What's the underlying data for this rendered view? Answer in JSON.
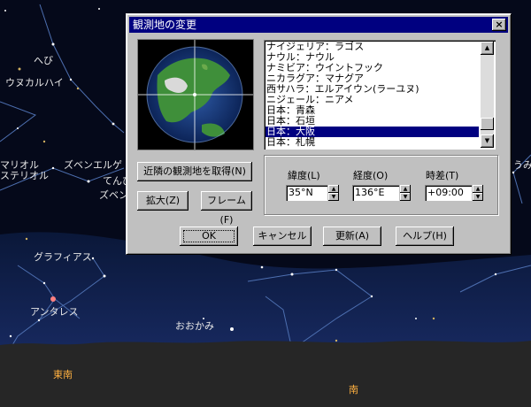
{
  "window": {
    "title": "観測地の変更",
    "close_glyph": "×"
  },
  "locations": [
    "ナイジェリア：ラゴス",
    "ナウル：ナウル",
    "ナミビア：ウイントフック",
    "ニカラグア：マナグア",
    "西サハラ：エルアイウン(ラーユヌ)",
    "ニジェール：ニアメ",
    "日本：青森",
    "日本：石垣",
    "日本：大阪",
    "日本：札幌"
  ],
  "selected_index": 8,
  "buttons": {
    "nearest": "近隣の観測地を取得(N)",
    "zoom": "拡大(Z)",
    "frame": "フレーム(F)",
    "ok": "OK",
    "cancel": "キャンセル",
    "update": "更新(A)",
    "help": "ヘルプ(H)"
  },
  "fields": {
    "latitude_label": "緯度(L)",
    "longitude_label": "経度(O)",
    "timezone_label": "時差(T)",
    "latitude_value": "35°N",
    "longitude_value": "136°E",
    "timezone_value": "+09:00"
  },
  "sky_labels": {
    "hebi": "へび",
    "ozhukahai": "ウヌカルハイ",
    "zubenelgenubi": "ズベンエルゲ",
    "tenbin": "てんび",
    "zubenelgenubi2": "ズベン",
    "mariolu": "マリオル",
    "sterior": "ステリオル",
    "graffias": "グラフィアス",
    "antares": "アンタレス",
    "ookami": "おおかみ",
    "umi": "うみ",
    "southeast": "東南",
    "south": "南"
  },
  "colors": {
    "title_bg": "#000080",
    "dialog_bg": "#c0c0c0",
    "sky": "#05091a",
    "direction": "#ffb040"
  }
}
